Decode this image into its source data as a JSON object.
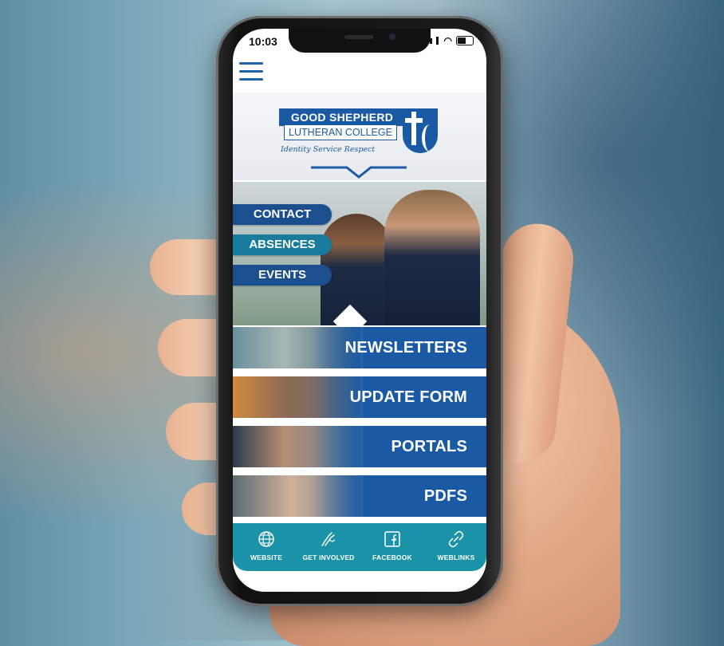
{
  "status_bar": {
    "time": "10:03"
  },
  "header": {
    "menu_icon": "hamburger-menu-icon",
    "logo": {
      "line1": "GOOD SHEPHERD",
      "line2": "LUTHERAN COLLEGE",
      "tagline": "Identity  Service  Respect"
    }
  },
  "quick_links": [
    {
      "label": "CONTACT"
    },
    {
      "label": "ABSENCES"
    },
    {
      "label": "EVENTS"
    }
  ],
  "menu_rows": [
    {
      "label": "NEWSLETTERS"
    },
    {
      "label": "UPDATE FORM"
    },
    {
      "label": "PORTALS"
    },
    {
      "label": "PDFS"
    }
  ],
  "bottom_nav": [
    {
      "label": "WEBSITE",
      "icon": "globe-icon"
    },
    {
      "label": "GET INVOLVED",
      "icon": "hands-icon"
    },
    {
      "label": "FACEBOOK",
      "icon": "facebook-icon"
    },
    {
      "label": "WEBLINKS",
      "icon": "link-icon"
    }
  ],
  "colors": {
    "brand_blue": "#1a5aa4",
    "teal": "#1a93a8",
    "navy_tab": "#1c4f8d"
  }
}
